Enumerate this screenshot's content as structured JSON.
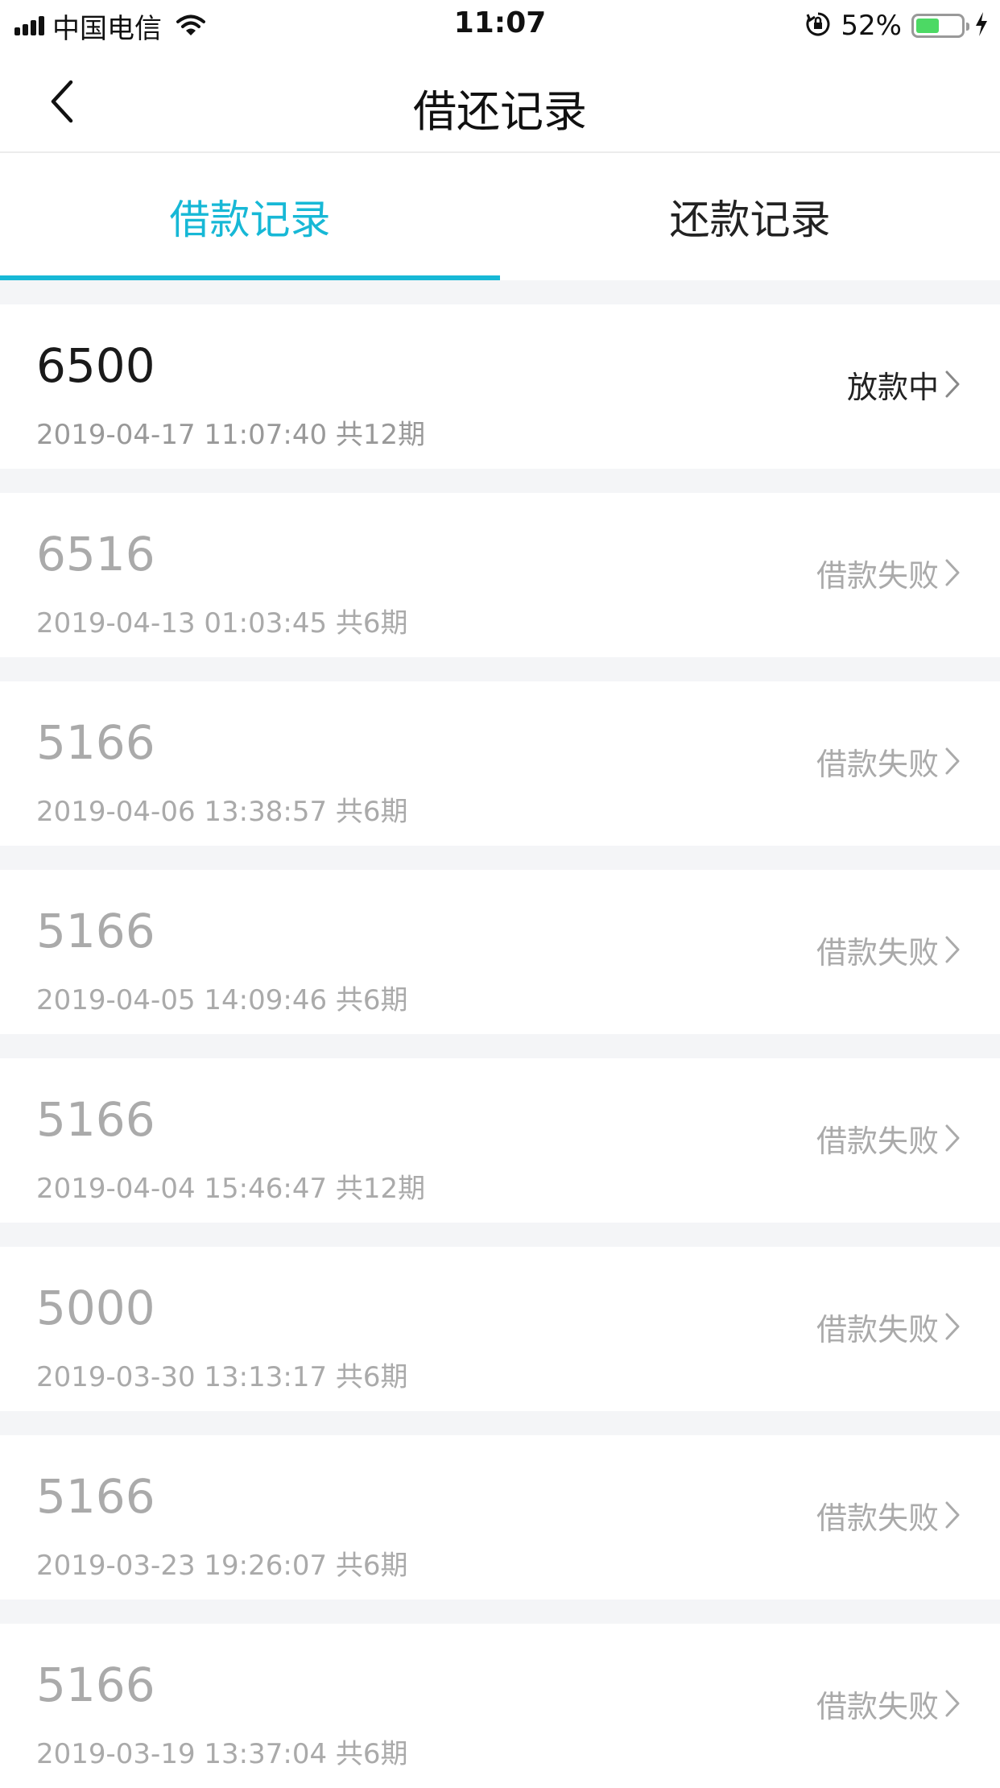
{
  "status_bar": {
    "carrier": "中国电信",
    "time": "11:07",
    "battery_percent": "52%",
    "battery_level": 0.52,
    "icons": [
      "signal-icon",
      "wifi-icon",
      "orientation-lock-icon",
      "battery-icon",
      "charging-icon"
    ]
  },
  "nav": {
    "title": "借还记录",
    "back_icon": "chevron-left-icon"
  },
  "tabs": [
    {
      "label": "借款记录",
      "active": true
    },
    {
      "label": "还款记录",
      "active": false
    }
  ],
  "colors": {
    "accent": "#17b8d6",
    "muted_text": "#aaaaaa",
    "primary_text": "#1a1a1a",
    "background": "#f4f5f7"
  },
  "records": [
    {
      "amount": "6500",
      "meta": "2019-04-17 11:07:40 共12期",
      "status": "放款中",
      "active": true
    },
    {
      "amount": "6516",
      "meta": "2019-04-13 01:03:45 共6期",
      "status": "借款失败",
      "active": false
    },
    {
      "amount": "5166",
      "meta": "2019-04-06 13:38:57 共6期",
      "status": "借款失败",
      "active": false
    },
    {
      "amount": "5166",
      "meta": "2019-04-05 14:09:46 共6期",
      "status": "借款失败",
      "active": false
    },
    {
      "amount": "5166",
      "meta": "2019-04-04 15:46:47 共12期",
      "status": "借款失败",
      "active": false
    },
    {
      "amount": "5000",
      "meta": "2019-03-30 13:13:17 共6期",
      "status": "借款失败",
      "active": false
    },
    {
      "amount": "5166",
      "meta": "2019-03-23 19:26:07 共6期",
      "status": "借款失败",
      "active": false
    },
    {
      "amount": "5166",
      "meta": "2019-03-19 13:37:04 共6期",
      "status": "借款失败",
      "active": false
    }
  ]
}
